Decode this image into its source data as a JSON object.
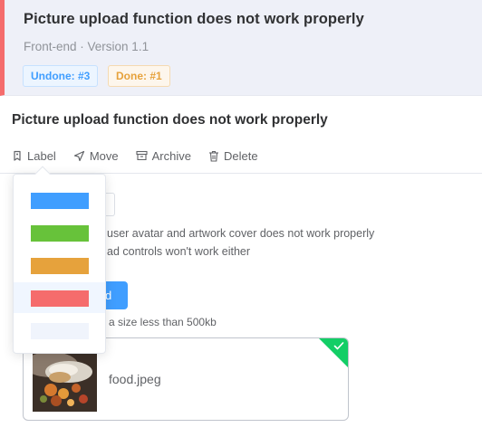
{
  "card": {
    "title": "Picture upload function does not work properly",
    "meta": "Front-end · Version 1.1",
    "badges": {
      "undone": "Undone: #3",
      "done": "Done: #1"
    },
    "accent_color": "#f56c6c"
  },
  "detail": {
    "title": "Picture upload function does not work properly",
    "toolbar": {
      "label": "Label",
      "move": "Move",
      "archive": "Archive",
      "delete": "Delete"
    },
    "description": [
      "user avatar and artwork cover does not work properly",
      "ad controls won't work either"
    ],
    "upload_button_label": "d",
    "upload_hint": "a size less than 500kb",
    "file": {
      "name": "food.jpeg",
      "status": "success",
      "icon": "check-icon"
    }
  },
  "label_dropdown": {
    "colors": [
      "#409eff",
      "#67c23a",
      "#e6a23c",
      "#f56c6c",
      "#f0f4fc"
    ],
    "hovered_index": 3
  }
}
